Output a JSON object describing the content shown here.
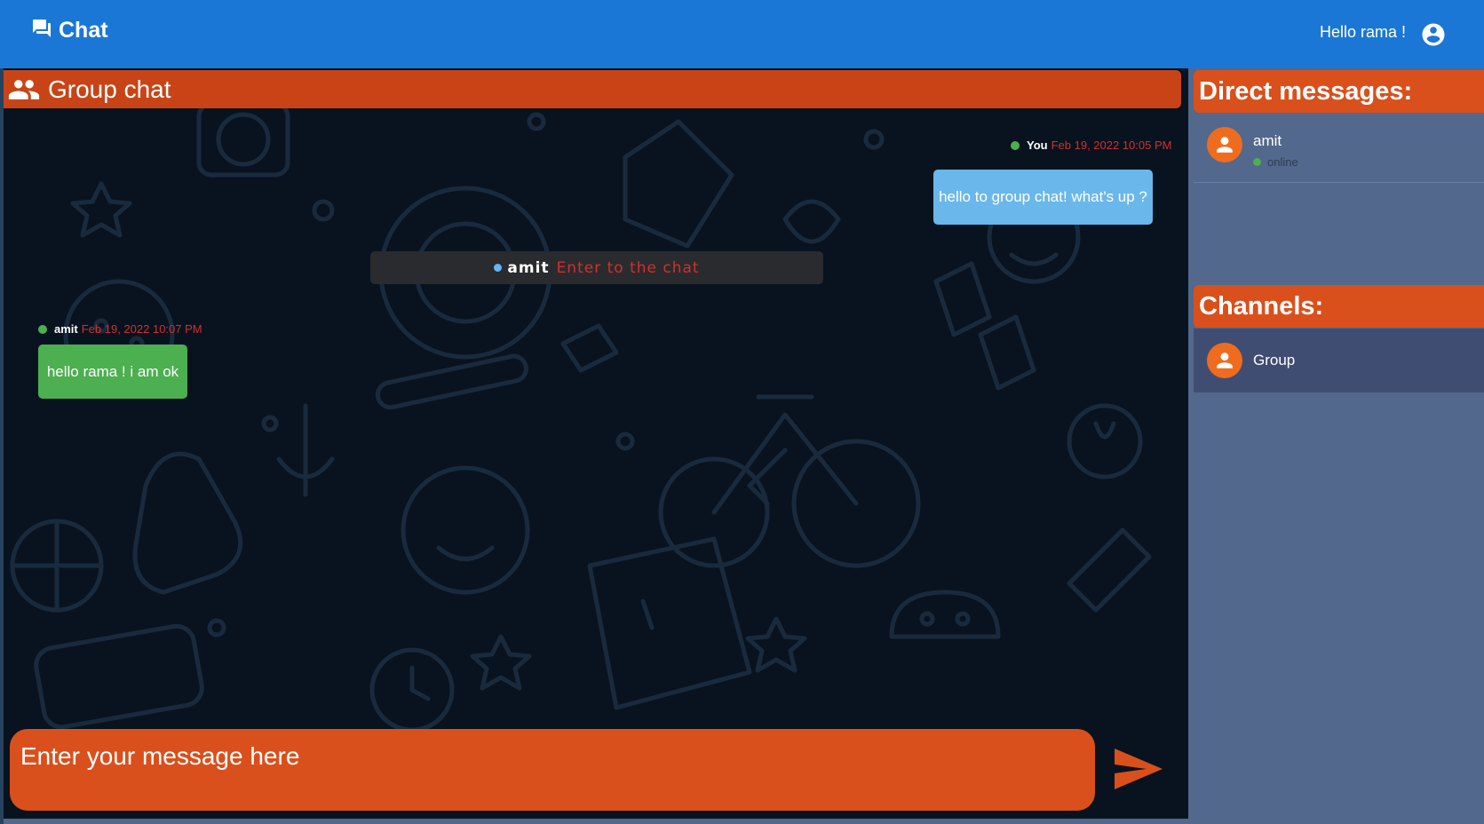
{
  "navbar": {
    "brand": "Chat",
    "greeting": "Hello rama !",
    "brand_icon": "forum-icon",
    "account_icon": "account-circle-icon"
  },
  "chat": {
    "title": "Group chat",
    "title_icon": "group-icon",
    "messages": [
      {
        "sender": "You",
        "time": "Feb 19, 2022 10:05 PM",
        "text": "hello to group chat! what's up ?",
        "side": "right"
      },
      {
        "sender": "amit",
        "time": "Feb 19, 2022 10:07 PM",
        "text": "hello rama ! i am ok",
        "side": "left"
      }
    ],
    "notice": {
      "name": "amit",
      "action": "Enter to the chat"
    },
    "composer_placeholder": "Enter your message here",
    "send_icon": "send-icon"
  },
  "sidebar": {
    "direct_header": "Direct messages:",
    "direct_messages": [
      {
        "name": "amit",
        "status": "online"
      }
    ],
    "channels_header": "Channels:",
    "channels": [
      {
        "name": "Group"
      }
    ]
  },
  "colors": {
    "navbar": "#1a77d6",
    "accent": "#d9501c",
    "chat_bg": "#08131f",
    "sidebar_bg": "#52688c",
    "mine_bubble": "#6ab7eb",
    "their_bubble": "#4caf50",
    "time": "#d32f2f"
  }
}
